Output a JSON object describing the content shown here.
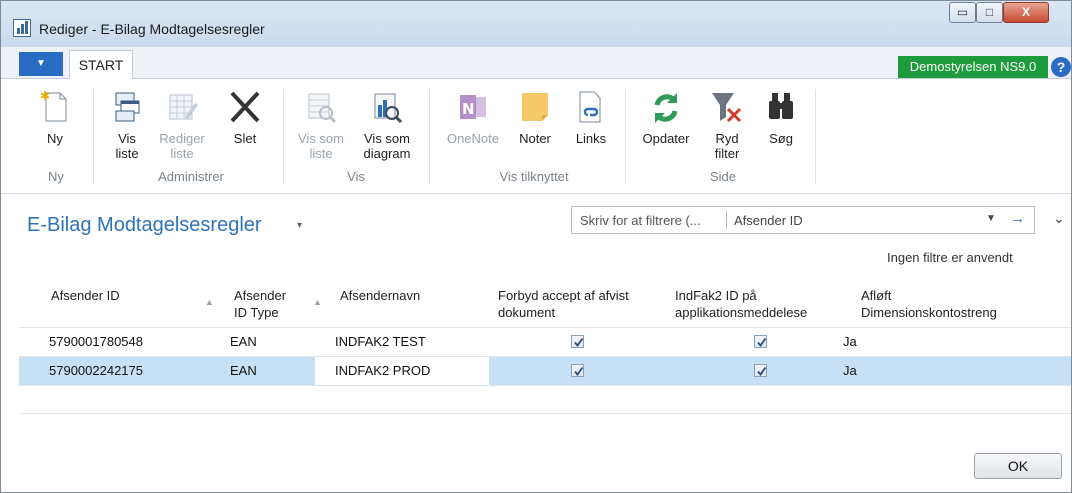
{
  "window": {
    "title": "Rediger - E-Bilag Modtagelsesregler",
    "minimize": "▭",
    "maximize": "□",
    "close": "X"
  },
  "tabbar": {
    "app_menu": "▼",
    "tab_start": "START",
    "company": "Demostyrelsen NS9.0",
    "help": "?"
  },
  "ribbon": {
    "buttons": {
      "ny": "Ny",
      "vis_liste": "Vis\nliste",
      "rediger_liste": "Rediger\nliste",
      "slet": "Slet",
      "vis_som_liste": "Vis som\nliste",
      "vis_som_diagram": "Vis som\ndiagram",
      "onenote": "OneNote",
      "noter": "Noter",
      "links": "Links",
      "opdater": "Opdater",
      "ryd_filter": "Ryd\nfilter",
      "soeg": "Søg"
    },
    "groups": {
      "ny": "Ny",
      "administrer": "Administrer",
      "vis": "Vis",
      "vis_tilknyttet": "Vis tilknyttet",
      "side": "Side"
    }
  },
  "list": {
    "title": "E-Bilag Modtagelsesregler",
    "caret": "▾",
    "filter_placeholder": "Skriv for at filtrere (...",
    "filter_field": "Afsender ID",
    "filter_dropdown": "▼",
    "filter_go": "→",
    "expand": "⌄",
    "no_filters": "Ingen filtre er anvendt"
  },
  "table": {
    "columns": {
      "afsender_id": "Afsender ID",
      "afsender_id_type": "Afsender\nID Type",
      "afsendernavn": "Afsendernavn",
      "forbyd_accept": "Forbyd accept af afvist\ndokument",
      "indfak2_id": "IndFak2 ID på\napplikationsmeddelese",
      "afloeft": "Afløft\nDimensionskontostreng"
    },
    "sort_arrow": "▲",
    "rows": [
      {
        "afsender_id": "5790001780548",
        "afsender_id_type": "EAN",
        "afsendernavn": "INDFAK2 TEST",
        "forbyd_accept": true,
        "indfak2_id": true,
        "afloeft": "Ja"
      },
      {
        "afsender_id": "5790002242175",
        "afsender_id_type": "EAN",
        "afsendernavn": "INDFAK2 PROD",
        "forbyd_accept": true,
        "indfak2_id": true,
        "afloeft": "Ja"
      }
    ]
  },
  "footer": {
    "ok": "OK"
  },
  "colors": {
    "accent": "#2d73b8",
    "company_badge": "#1e9b3c",
    "selected_row": "#c6e0f6"
  }
}
